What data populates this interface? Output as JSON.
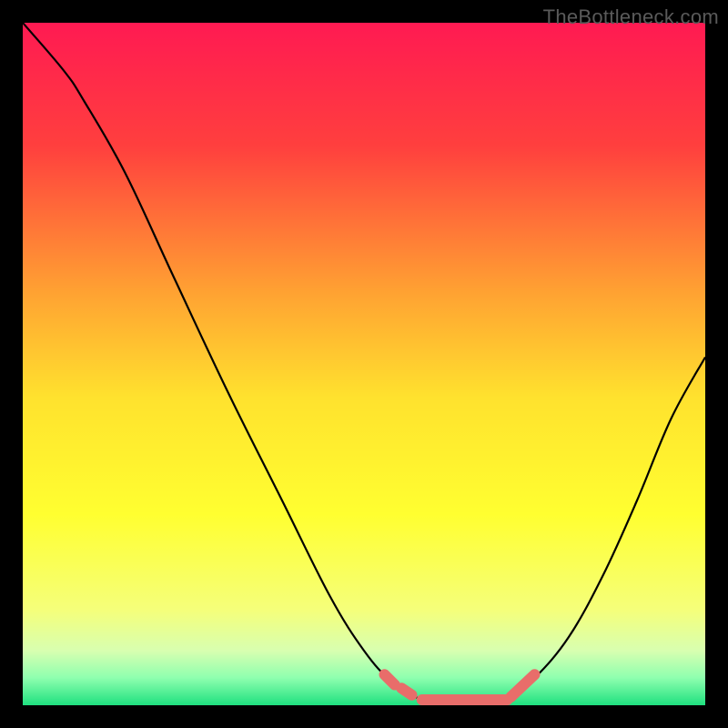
{
  "watermark": "TheBottleneck.com",
  "chart_data": {
    "type": "line",
    "title": "",
    "xlabel": "",
    "ylabel": "",
    "xlim": [
      0,
      100
    ],
    "ylim": [
      0,
      100
    ],
    "gradient_stops": [
      {
        "offset": 0,
        "color": "#ff1a52"
      },
      {
        "offset": 0.18,
        "color": "#ff3f3e"
      },
      {
        "offset": 0.4,
        "color": "#ffa432"
      },
      {
        "offset": 0.55,
        "color": "#ffe22e"
      },
      {
        "offset": 0.72,
        "color": "#ffff30"
      },
      {
        "offset": 0.86,
        "color": "#f5ff7a"
      },
      {
        "offset": 0.92,
        "color": "#d8ffb0"
      },
      {
        "offset": 0.96,
        "color": "#8effaf"
      },
      {
        "offset": 1.0,
        "color": "#1fe07f"
      }
    ],
    "curve": [
      {
        "x": 0.0,
        "y": 100.0
      },
      {
        "x": 6.0,
        "y": 93.0
      },
      {
        "x": 9.0,
        "y": 88.5
      },
      {
        "x": 15.0,
        "y": 78.0
      },
      {
        "x": 22.0,
        "y": 63.0
      },
      {
        "x": 30.0,
        "y": 46.0
      },
      {
        "x": 38.0,
        "y": 30.0
      },
      {
        "x": 45.0,
        "y": 16.0
      },
      {
        "x": 50.0,
        "y": 8.0
      },
      {
        "x": 54.0,
        "y": 3.5
      },
      {
        "x": 58.0,
        "y": 1.0
      },
      {
        "x": 62.0,
        "y": 0.0
      },
      {
        "x": 67.0,
        "y": 0.0
      },
      {
        "x": 71.0,
        "y": 1.0
      },
      {
        "x": 75.0,
        "y": 4.0
      },
      {
        "x": 80.0,
        "y": 10.0
      },
      {
        "x": 85.0,
        "y": 19.0
      },
      {
        "x": 90.0,
        "y": 30.0
      },
      {
        "x": 95.0,
        "y": 42.0
      },
      {
        "x": 100.0,
        "y": 51.0
      }
    ],
    "overlay_color": "#e86d6a",
    "overlay_segments": [
      {
        "x1": 53.0,
        "y1": 4.5,
        "x2": 54.5,
        "y2": 3.0
      },
      {
        "x1": 55.5,
        "y1": 2.5,
        "x2": 57.0,
        "y2": 1.5
      },
      {
        "x1": 58.5,
        "y1": 0.8,
        "x2": 71.0,
        "y2": 0.8
      },
      {
        "x1": 71.5,
        "y1": 1.2,
        "x2": 75.0,
        "y2": 4.5
      }
    ]
  }
}
